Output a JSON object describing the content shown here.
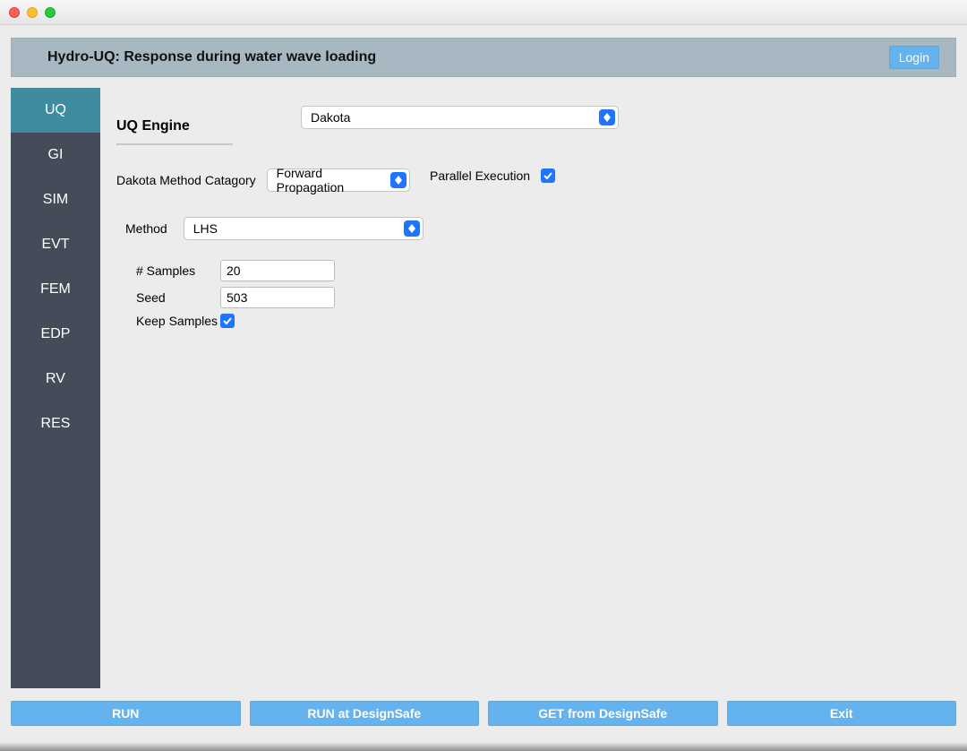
{
  "header": {
    "title": "Hydro-UQ: Response during water wave loading",
    "login": "Login"
  },
  "sidebar": {
    "active_index": 0,
    "items": [
      "UQ",
      "GI",
      "SIM",
      "EVT",
      "FEM",
      "EDP",
      "RV",
      "RES"
    ]
  },
  "uq": {
    "engine_label": "UQ Engine",
    "engine_value": "Dakota",
    "category_label": "Dakota Method Catagory",
    "category_value": "Forward Propagation",
    "parallel_label": "Parallel Execution",
    "parallel_checked": true,
    "method_label": "Method",
    "method_value": "LHS",
    "samples_label": "# Samples",
    "samples_value": "20",
    "seed_label": "Seed",
    "seed_value": "503",
    "keep_label": "Keep Samples",
    "keep_checked": true
  },
  "footer": {
    "run": "RUN",
    "run_ds": "RUN at DesignSafe",
    "get_ds": "GET from DesignSafe",
    "exit": "Exit"
  }
}
